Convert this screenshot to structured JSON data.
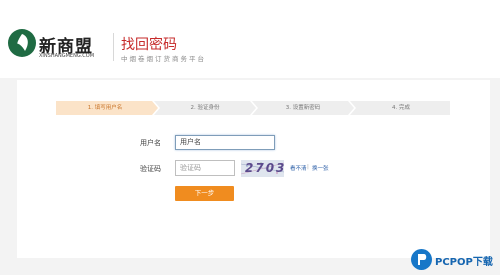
{
  "brand": {
    "name": "新商盟",
    "subtitle": "XINSHANGMENG.COM"
  },
  "page": {
    "title": "找回密码",
    "subtitle": "中烟卷烟订货商务平台"
  },
  "steps": [
    {
      "label": "1. 填写用户名",
      "state": "active"
    },
    {
      "label": "2. 验证身份",
      "state": "pending"
    },
    {
      "label": "3. 设置新密码",
      "state": "pending"
    },
    {
      "label": "4. 完成",
      "state": "pending"
    }
  ],
  "form": {
    "username_label": "用户名",
    "username_placeholder": "用户名",
    "captcha_label": "验证码",
    "captcha_placeholder": "验证码",
    "captcha_text": "2703",
    "captcha_unclear": "看不清",
    "captcha_refresh": "换一张",
    "next_button": "下一步"
  },
  "watermark": {
    "text": "PCPOP下载"
  },
  "colors": {
    "brand_green": "#1f6b43",
    "title_red": "#c62a2a",
    "step_active": "#fbe3c8",
    "step_pending": "#eeeeee",
    "button_orange": "#f08c1f",
    "link_blue": "#2c5fa8"
  }
}
